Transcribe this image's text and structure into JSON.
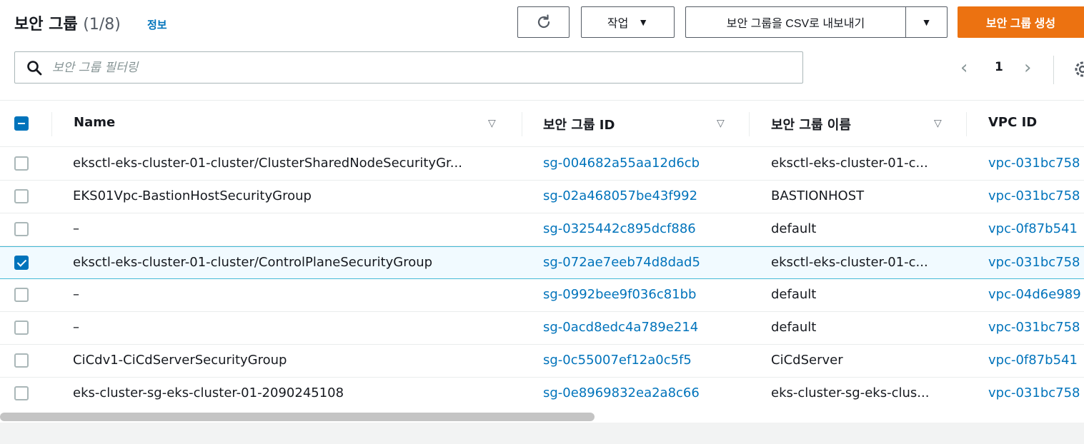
{
  "header": {
    "title": "보안 그룹",
    "count": "(1/8)",
    "info_link": "정보",
    "actions_label": "작업",
    "export_label": "보안 그룹을 CSV로 내보내기",
    "create_label": "보안 그룹 생성"
  },
  "filter": {
    "placeholder": "보안 그룹 필터링",
    "value": ""
  },
  "pagination": {
    "current_page": "1"
  },
  "table": {
    "columns": [
      "Name",
      "보안 그룹 ID",
      "보안 그룹 이름",
      "VPC ID"
    ],
    "rows": [
      {
        "name": "eksctl-eks-cluster-01-cluster/ClusterSharedNodeSecurityGr...",
        "id": "sg-004682a55aa12d6cb",
        "group_name": "eksctl-eks-cluster-01-c...",
        "vpc": "vpc-031bc758",
        "selected": false
      },
      {
        "name": "EKS01Vpc-BastionHostSecurityGroup",
        "id": "sg-02a468057be43f992",
        "group_name": "BASTIONHOST",
        "vpc": "vpc-031bc758",
        "selected": false
      },
      {
        "name": "–",
        "id": "sg-0325442c895dcf886",
        "group_name": "default",
        "vpc": "vpc-0f87b541",
        "selected": false
      },
      {
        "name": "eksctl-eks-cluster-01-cluster/ControlPlaneSecurityGroup",
        "id": "sg-072ae7eeb74d8dad5",
        "group_name": "eksctl-eks-cluster-01-c...",
        "vpc": "vpc-031bc758",
        "selected": true
      },
      {
        "name": "–",
        "id": "sg-0992bee9f036c81bb",
        "group_name": "default",
        "vpc": "vpc-04d6e989",
        "selected": false
      },
      {
        "name": "–",
        "id": "sg-0acd8edc4a789e214",
        "group_name": "default",
        "vpc": "vpc-031bc758",
        "selected": false
      },
      {
        "name": "CiCdv1-CiCdServerSecurityGroup",
        "id": "sg-0c55007ef12a0c5f5",
        "group_name": "CiCdServer",
        "vpc": "vpc-0f87b541",
        "selected": false
      },
      {
        "name": "eks-cluster-sg-eks-cluster-01-2090245108",
        "id": "sg-0e8969832ea2a8c66",
        "group_name": "eks-cluster-sg-eks-clus...",
        "vpc": "vpc-031bc758",
        "selected": false
      }
    ]
  },
  "colors": {
    "primary": "#ec7211",
    "link": "#0073bb",
    "selected_border": "#44b9d6"
  },
  "icons": {
    "refresh": "refresh-icon",
    "search": "search-icon",
    "settings": "gear-icon"
  }
}
